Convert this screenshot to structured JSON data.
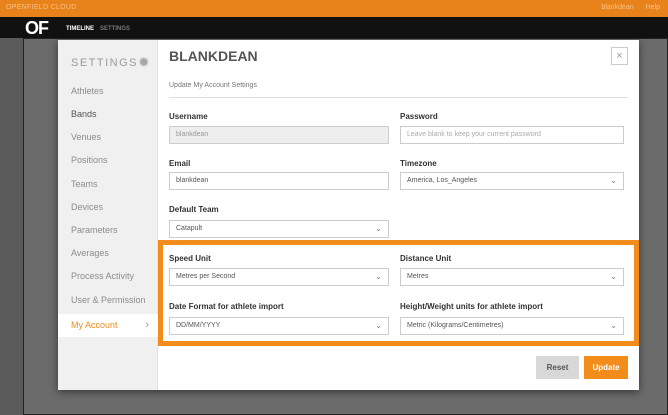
{
  "topbar": {
    "brand": "OPENFIELD CLOUD",
    "user": "blankdean",
    "help": "Help"
  },
  "navbar": {
    "logo": "OF",
    "tab_timeline": "TIMELINE",
    "tab_settings": "SETTINGS"
  },
  "sidebar": {
    "heading": "SETTINGS",
    "items": [
      {
        "label": "Athletes"
      },
      {
        "label": "Bands"
      },
      {
        "label": "Venues"
      },
      {
        "label": "Positions"
      },
      {
        "label": "Teams"
      },
      {
        "label": "Devices"
      },
      {
        "label": "Parameters"
      },
      {
        "label": "Averages"
      },
      {
        "label": "Process Activity"
      },
      {
        "label": "User & Permission"
      },
      {
        "label": "My Account"
      }
    ]
  },
  "modal": {
    "title": "BLANKDEAN",
    "close": "×",
    "subtitle": "Update My Account Settings"
  },
  "form": {
    "username": {
      "label": "Username",
      "value": "blankdean"
    },
    "password": {
      "label": "Password",
      "placeholder": "Leave blank to keep your current password"
    },
    "email": {
      "label": "Email",
      "value": "blankdean"
    },
    "timezone": {
      "label": "Timezone",
      "value": "America, Los_Angeles"
    },
    "default_team": {
      "label": "Default Team",
      "value": "Catapult"
    },
    "speed_unit": {
      "label": "Speed Unit",
      "value": "Metres per Second"
    },
    "distance_unit": {
      "label": "Distance Unit",
      "value": "Metres"
    },
    "date_format": {
      "label": "Date Format for athlete import",
      "value": "DD/MM/YYYY"
    },
    "height_weight": {
      "label": "Height/Weight units for athlete import",
      "value": "Metric (Kilograms/Centimetres)"
    }
  },
  "buttons": {
    "reset": "Reset",
    "update": "Update"
  },
  "colors": {
    "accent": "#f28c1a",
    "topbar": "#e8821a",
    "navbar": "#111111"
  }
}
